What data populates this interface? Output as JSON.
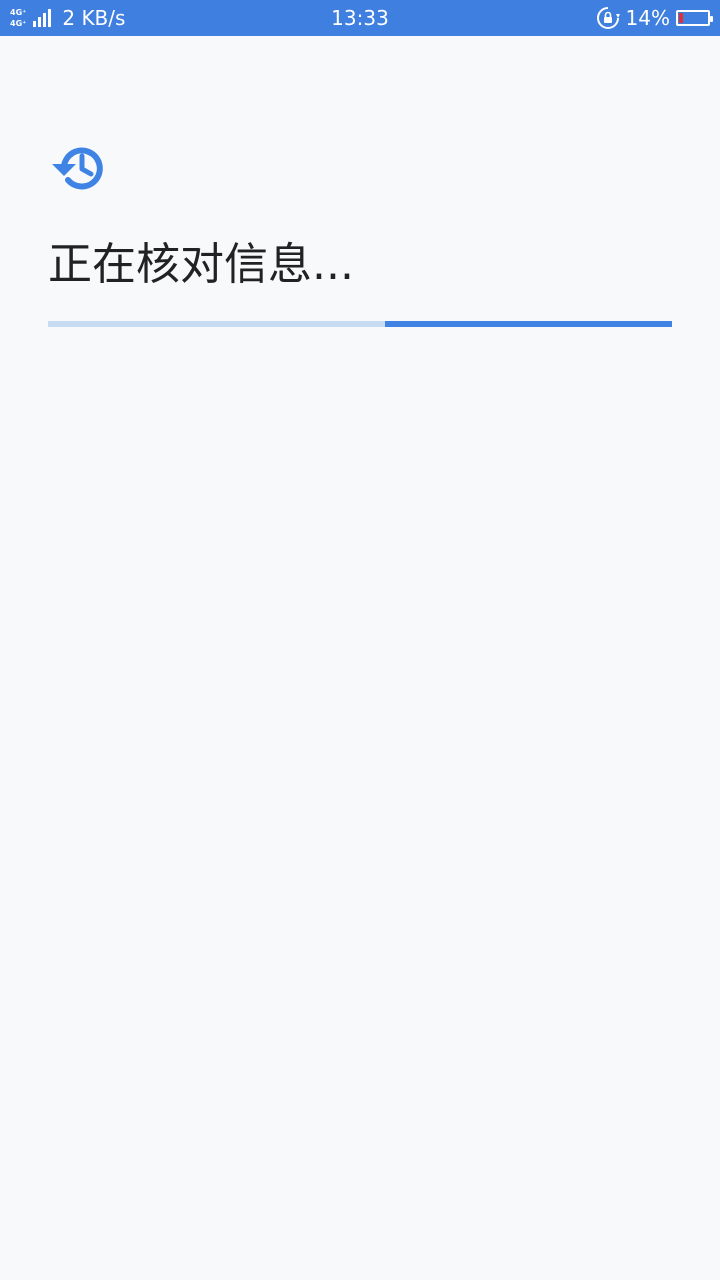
{
  "status_bar": {
    "network_type_1": "4G⁺",
    "network_type_2": "4G⁺",
    "net_speed": "2 KB/s",
    "time": "13:33",
    "battery_percent_text": "14%",
    "battery_level": 0.14,
    "icons": [
      "signal-icon",
      "rotation-lock-icon",
      "battery-icon"
    ]
  },
  "main": {
    "icon": "history-icon",
    "title": "正在核对信息...",
    "progress": {
      "indeterminate": true,
      "track_color": "#c8dcf4",
      "fill_color": "#3f84e5",
      "visible_fill_start": 0.54,
      "visible_fill_end": 1.0
    }
  },
  "colors": {
    "status_bar_bg": "#3f7fe0",
    "accent": "#3f84e5",
    "background": "#f8f9fb",
    "battery_low": "#e03131"
  }
}
